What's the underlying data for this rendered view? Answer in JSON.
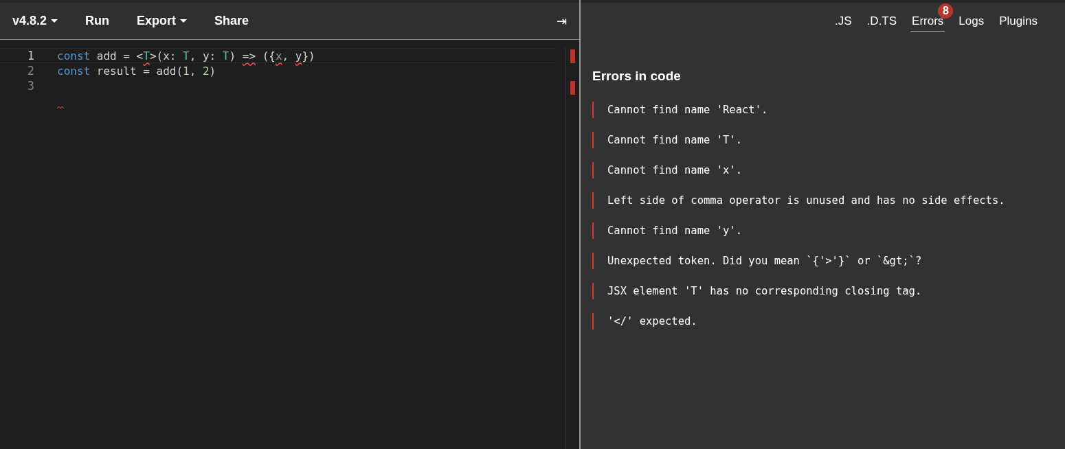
{
  "toolbar": {
    "items": [
      {
        "label": "v4.8.2",
        "dropdown": true
      },
      {
        "label": "Run",
        "dropdown": false
      },
      {
        "label": "Export",
        "dropdown": true
      },
      {
        "label": "Share",
        "dropdown": false
      }
    ],
    "collapse_icon": "⇥"
  },
  "editor": {
    "lines": [
      {
        "number": "1",
        "active": true,
        "error_mark": false,
        "tokens": [
          {
            "text": "const",
            "kind": "keyword",
            "squiggle": false
          },
          {
            "text": " add = <",
            "kind": "plain",
            "squiggle": false
          },
          {
            "text": "T",
            "kind": "type",
            "squiggle": true
          },
          {
            "text": ">(x: ",
            "kind": "plain",
            "squiggle": false
          },
          {
            "text": "T",
            "kind": "type",
            "squiggle": false
          },
          {
            "text": ", y: ",
            "kind": "plain",
            "squiggle": false
          },
          {
            "text": "T",
            "kind": "type",
            "squiggle": false
          },
          {
            "text": ") ",
            "kind": "plain",
            "squiggle": false
          },
          {
            "text": "=>",
            "kind": "plain",
            "squiggle": true
          },
          {
            "text": " ({",
            "kind": "plain",
            "squiggle": false
          },
          {
            "text": "x",
            "kind": "dim",
            "squiggle": true
          },
          {
            "text": ", ",
            "kind": "plain",
            "squiggle": false
          },
          {
            "text": "y",
            "kind": "plain",
            "squiggle": true
          },
          {
            "text": "})",
            "kind": "plain",
            "squiggle": false
          }
        ]
      },
      {
        "number": "2",
        "active": false,
        "error_mark": false,
        "tokens": [
          {
            "text": "const",
            "kind": "keyword",
            "squiggle": false
          },
          {
            "text": " result = add(",
            "kind": "plain",
            "squiggle": false
          },
          {
            "text": "1",
            "kind": "number",
            "squiggle": false
          },
          {
            "text": ", ",
            "kind": "plain",
            "squiggle": false
          },
          {
            "text": "2",
            "kind": "number",
            "squiggle": false
          },
          {
            "text": ")",
            "kind": "plain",
            "squiggle": false
          }
        ]
      },
      {
        "number": "3",
        "active": false,
        "error_mark": true
      }
    ]
  },
  "tabs": [
    {
      "label": ".JS",
      "selected": false
    },
    {
      "label": ".D.TS",
      "selected": false
    },
    {
      "label": "Errors",
      "selected": true,
      "badge": "8"
    },
    {
      "label": "Logs",
      "selected": false
    },
    {
      "label": "Plugins",
      "selected": false
    }
  ],
  "errors": {
    "title": "Errors in code",
    "items": [
      "Cannot find name 'React'.",
      "Cannot find name 'T'.",
      "Cannot find name 'x'.",
      "Left side of comma operator is unused and has no side effects.",
      "Cannot find name 'y'.",
      "Unexpected token. Did you mean `{'>'}` or `&gt;`?",
      "JSX element 'T' has no corresponding closing tag.",
      "'</' expected."
    ]
  }
}
